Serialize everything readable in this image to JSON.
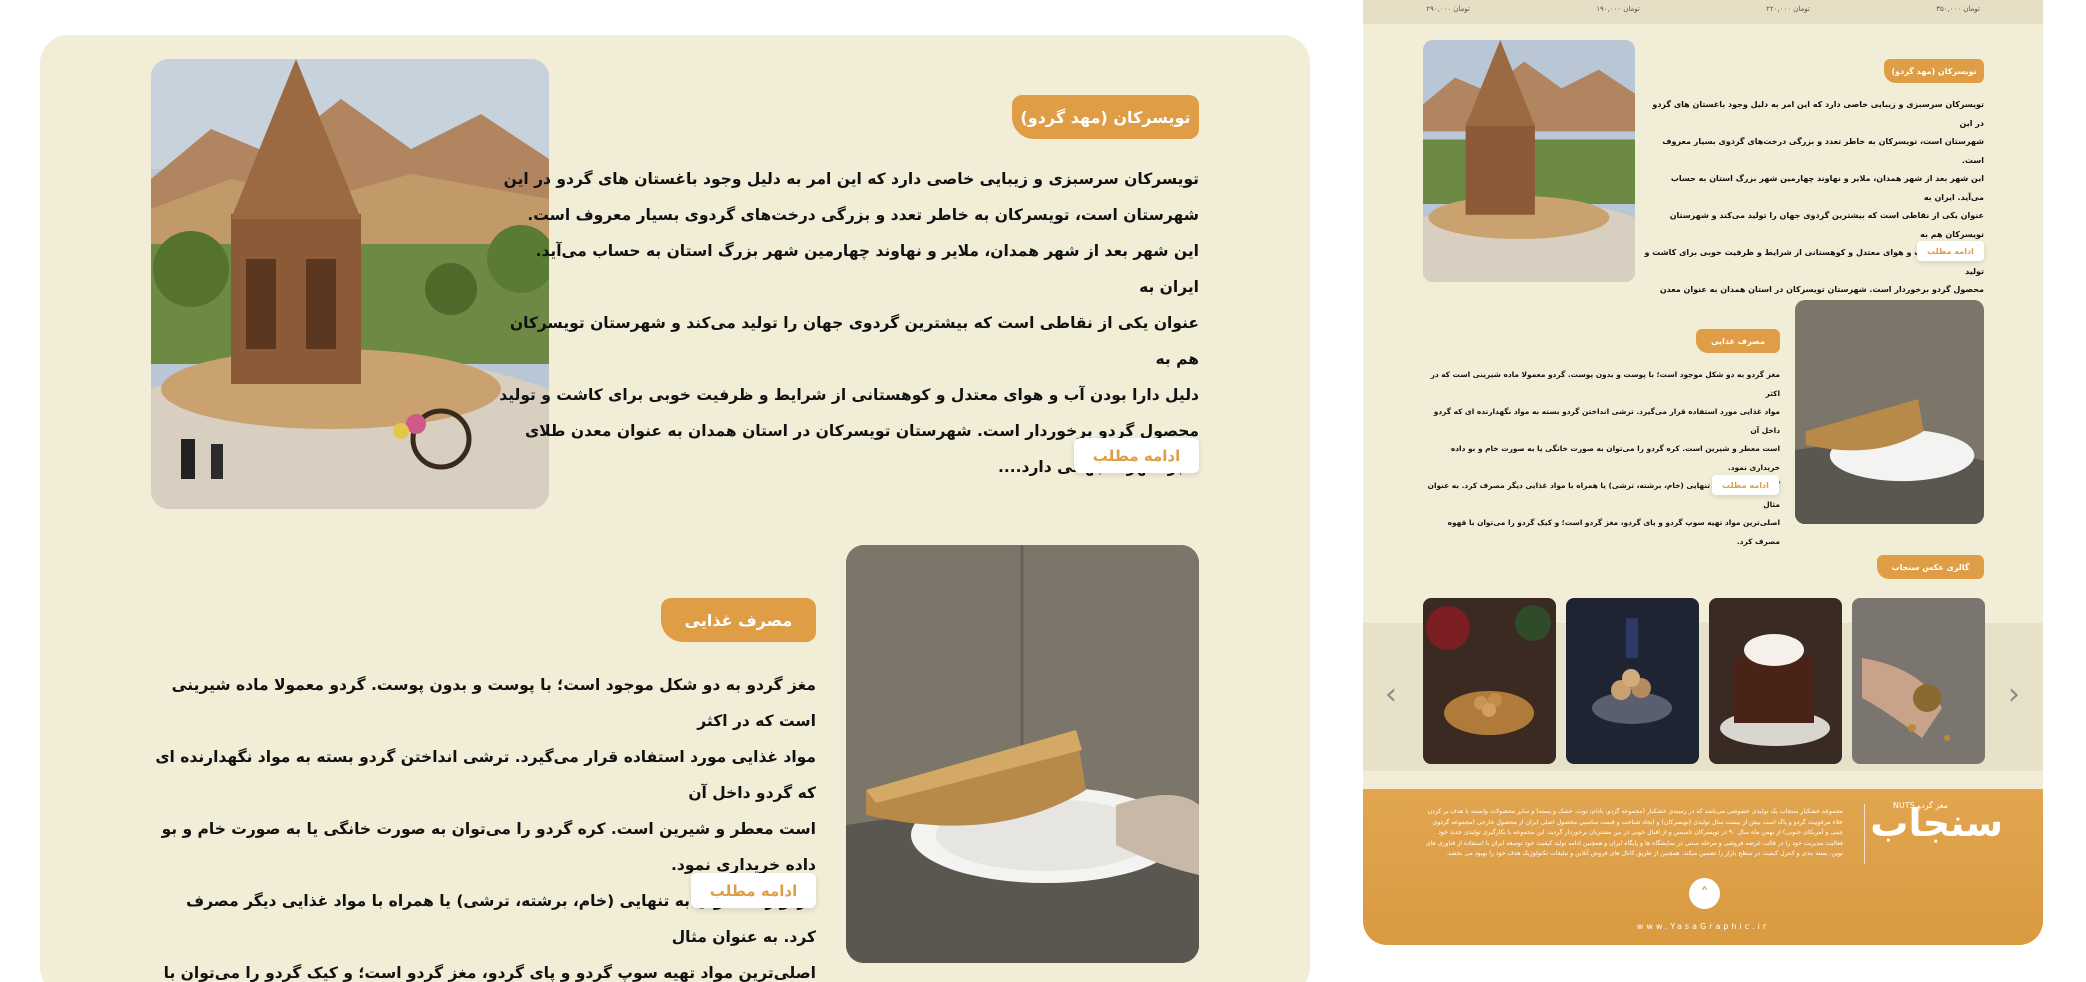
{
  "colors": {
    "accent": "#df9d45",
    "panel": "#f1edd7",
    "footer": "#dd9f48"
  },
  "section1": {
    "title": "تویسرکان (مهد گردو)",
    "lines": [
      "تویسرکان سرسبزی و زیبایی خاصی دارد که این امر به دلیل وجود  باغستان های گردو در این",
      "شهرستان است، تویسرکان به خاطر تعدد و بزرگی درخت‌های گردوی بسیار معروف است.",
      "این شهر بعد از شهر همدان، ملایر و نهاوند چهارمین شهر بزرگ استان به حساب می‌آید. ایران به",
      "عنوان یکی از نقاطی است که بیشترین گردوی جهان را تولید می‌کند و شهرستان تویسرکان هم به",
      "دلیل دارا بودن آب و هوای معتدل و کوهستانی از شرایط و ظرفیت خوبی برای کاشت و تولید",
      "محصول گردو برخوردار است. شهرستان تویسرکان در استان همدان به عنوان معدن طلای",
      "سبز،شهرت جهانی دارد...."
    ],
    "button": "ادامه مطلب"
  },
  "section2": {
    "title": "مصرف غذایی",
    "lines": [
      "مغز گردو به دو شکل موجود است؛ با پوست و بدون پوست. گردو معمولا ماده شیرینی است که در اکثر",
      "مواد غذایی مورد استفاده قرار می‌گیرد. ترشی انداختن گردو بسته به مواد نگهدارنده ای که گردو داخل آن",
      "است معطر و شیرین است. کره گردو را می‌توان به صورت خانگی یا به صورت خام و بو داده خریداری نمود.",
      "گردو را می‌توان به تنهایی (خام، برشته، ترشی) یا همراه با مواد غذایی دیگر مصرف کرد. به عنوان مثال",
      "اصلی‌ترین مواد تهیه سوپ گردو و پای گردو، مغز گردو است؛ و کیک گردو را می‌توان با قهوه مصرف کرد."
    ],
    "button": "ادامه مطلب"
  },
  "mobile": {
    "prices": [
      "۲۹۰,۰۰۰ تومان",
      "۱۹۰,۰۰۰ تومان",
      "۲۲۰,۰۰۰ تومان",
      "۳۵۰,۰۰۰ تومان"
    ],
    "gallery_title": "گالری عکس سنجاب",
    "footer_logo": "سنجاب",
    "footer_logo_small": "مغز گردو NUTS",
    "footer_text": "مجموعه خشکبار سنجاب یک تولیدی خصوصی می‌باشد که در زمینه‌ی خشکبار (مجموعه گردو، بادام، توت، خشک و پسته) و سایر محصولات وابسته با هدف بر کردن خلاء مرغوبیت گردو و پاک است بیش از بیست سال تولیدی (تویسرکان) و ایجاد شناخت و قیمت مناسبی محصول اصلی ایران از محصول خارجی (مجموعه گردوی چینی و آمریکای جنوبی) از بهمن ماه سال ۹۰ در تویسرکان تاسیس و از اقبال خوبی در بین مشتریان برخوردار گردید. این مجموعه با بکارگیری تولیدی جدید خود فعالیت مدیریت خود را در قالب عرضه فروشی و مرحله سنتی در نمایشگاه ها و پایگاه ایران و همچنین ادامه تولید کیفیت خود توسعه ایران با استفاده از فناوری های نوین، بسته بندی و کنترل کیفیت در سطح بازار را تضمین میکند. همچنین از طریق کانال های فروش آنلاین و تبلیغات تکنولوژیک هدف خود را بهبود می بخشد.",
    "site": "www.YasaGraphic.ir"
  }
}
